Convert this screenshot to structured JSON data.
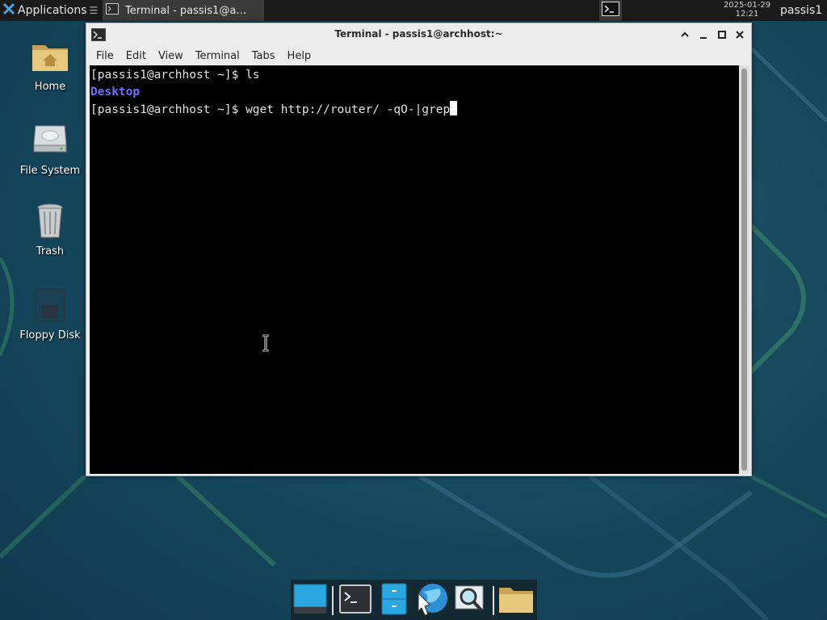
{
  "top_panel": {
    "apps_label": "Applications",
    "task_label": "Terminal - passis1@a…",
    "clock_date": "2025-01-29",
    "clock_time": "12:21",
    "user": "passis1"
  },
  "desktop": {
    "icons": [
      {
        "label": "Home",
        "icon": "home-folder-icon"
      },
      {
        "label": "File System",
        "icon": "hard-drive-icon"
      },
      {
        "label": "Trash",
        "icon": "trash-icon"
      },
      {
        "label": "Floppy Disk",
        "icon": "floppy-disk-icon"
      }
    ]
  },
  "window": {
    "title": "Terminal - passis1@archhost:~",
    "menu": [
      "File",
      "Edit",
      "View",
      "Terminal",
      "Tabs",
      "Help"
    ],
    "terminal": {
      "line1_prompt": "[passis1@archhost ~]$ ",
      "line1_cmd": "ls",
      "line2_output": "Desktop",
      "line3_prompt": "[passis1@archhost ~]$ ",
      "line3_cmd": "wget http://router/ -qO-|grep"
    }
  },
  "dock": {
    "items": [
      "show-desktop-icon",
      "terminal-icon",
      "file-manager-icon",
      "web-browser-icon",
      "app-finder-icon",
      "folder-icon"
    ]
  },
  "colors": {
    "directory_text": "#6f6fff",
    "terminal_bg": "#000000",
    "panel_bg": "#1b1b1b"
  }
}
